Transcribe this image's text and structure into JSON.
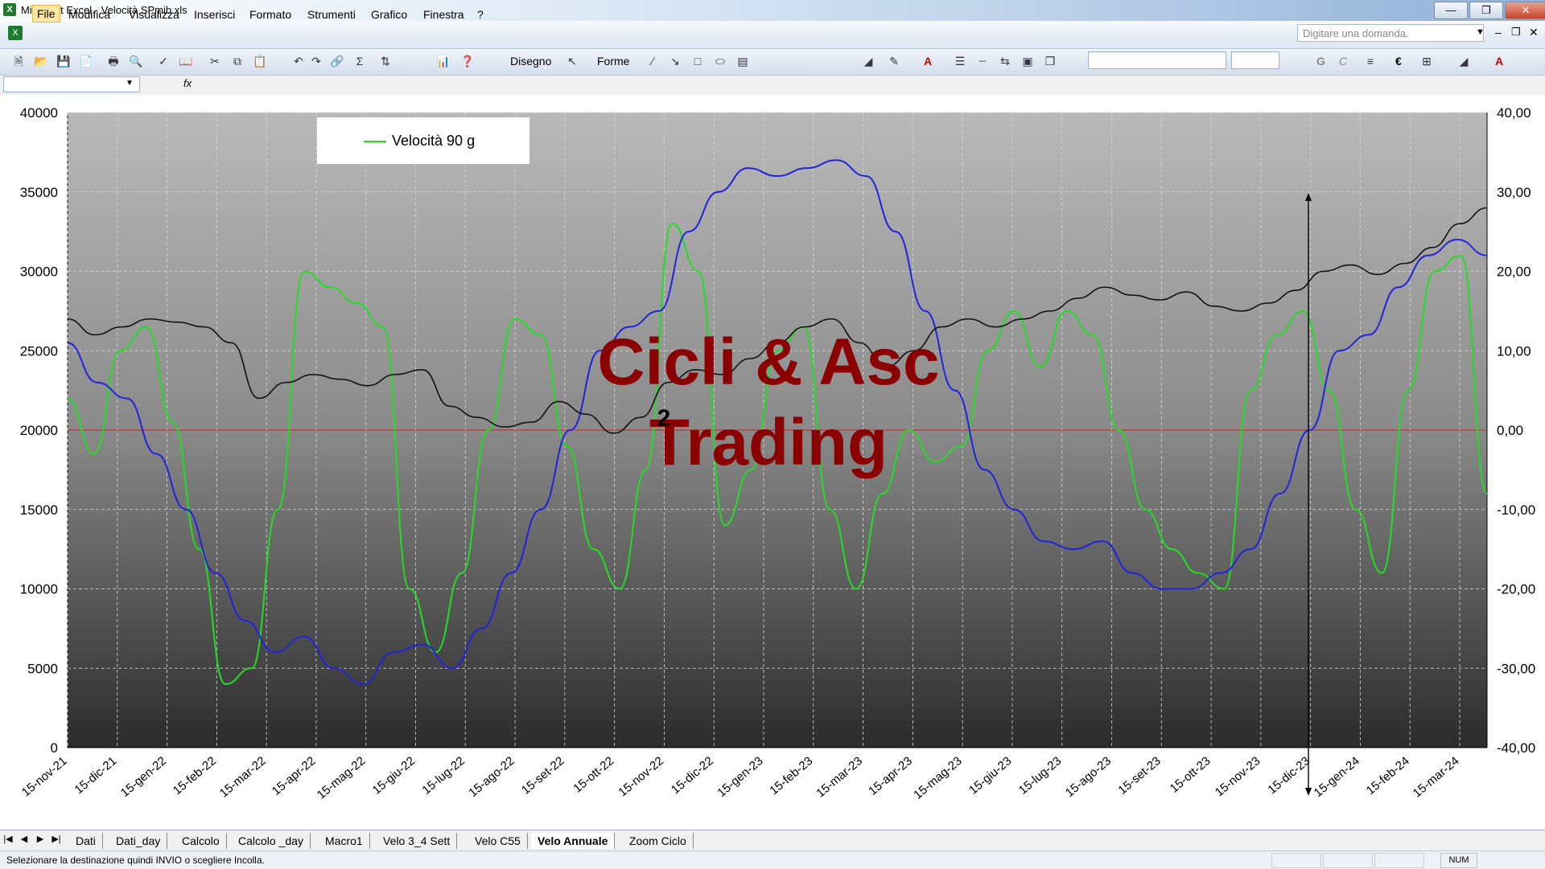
{
  "window": {
    "title": "Microsoft Excel - Velocità SPmib.xls",
    "icon": "excel-icon"
  },
  "menu": {
    "items": [
      "File",
      "Modifica",
      "Visualizza",
      "Inserisci",
      "Formato",
      "Strumenti",
      "Grafico",
      "Finestra",
      "?"
    ],
    "help_placeholder": "Digitare una domanda."
  },
  "toolbar": {
    "disegno_label": "Disegno",
    "forme_label": "Forme",
    "bold": "G",
    "italic": "C",
    "euro": "€"
  },
  "formula_bar": {
    "fx_label": "fx"
  },
  "chart": {
    "watermark_line1": "Cicli & Asc",
    "watermark_line2": "Trading",
    "marker_label": "2"
  },
  "chart_data": {
    "type": "line",
    "legend": {
      "entries": [
        "Velocità 90 g"
      ],
      "placement": "top-left"
    },
    "y_left": {
      "ylim": [
        0,
        40000
      ],
      "ticks": [
        "40000",
        "35000",
        "30000",
        "25000",
        "20000",
        "15000",
        "10000",
        "5000",
        "0"
      ]
    },
    "y_right": {
      "ylim": [
        -40,
        40
      ],
      "ticks": [
        "40,00",
        "30,00",
        "20,00",
        "10,00",
        "0,00",
        "-10,00",
        "-20,00",
        "-30,00",
        "-40,00"
      ]
    },
    "x_ticks": [
      "15-nov-21",
      "15-dic-21",
      "15-gen-22",
      "15-feb-22",
      "15-mar-22",
      "15-apr-22",
      "15-mag-22",
      "15-giu-22",
      "15-lug-22",
      "15-ago-22",
      "15-set-22",
      "15-ott-22",
      "15-nov-22",
      "15-dic-22",
      "15-gen-23",
      "15-feb-23",
      "15-mar-23",
      "15-apr-23",
      "15-mag-23",
      "15-giu-23",
      "15-lug-23",
      "15-ago-23",
      "15-set-23",
      "15-ott-23",
      "15-nov-23",
      "15-dic-23",
      "15-gen-24",
      "15-feb-24",
      "15-mar-24"
    ],
    "grid": true,
    "series": [
      {
        "name": "Velocità 90 g",
        "color": "#22dd22",
        "axis": "right",
        "values": [
          4,
          -3,
          10,
          13,
          1,
          -15,
          -32,
          -30,
          -10,
          20,
          18,
          16,
          13,
          -20,
          -28,
          -18,
          0,
          14,
          12,
          -2,
          -15,
          -20,
          -5,
          26,
          20,
          -12,
          -5,
          10,
          13,
          -10,
          -20,
          -8,
          0,
          -4,
          -2,
          10,
          15,
          8,
          15,
          12,
          0,
          -10,
          -15,
          -18,
          -20,
          5,
          12,
          15,
          5,
          -10,
          -18,
          5,
          20,
          22,
          -8
        ]
      },
      {
        "color": "#2222dd",
        "axis": "right",
        "values": [
          11,
          6,
          4,
          -3,
          -10,
          -18,
          -24,
          -28,
          -26,
          -30,
          -32,
          -28,
          -27,
          -30,
          -25,
          -18,
          -10,
          0,
          10,
          13,
          15,
          25,
          30,
          33,
          32,
          33,
          34,
          32,
          25,
          15,
          5,
          -5,
          -10,
          -14,
          -15,
          -14,
          -18,
          -20,
          -20,
          -18,
          -15,
          -8,
          0,
          10,
          12,
          18,
          22,
          24,
          22
        ]
      },
      {
        "color": "#111111",
        "axis": "left",
        "values": [
          27000,
          26000,
          26500,
          27000,
          26800,
          26500,
          25500,
          22000,
          23000,
          23500,
          23200,
          22800,
          23500,
          23800,
          21500,
          20800,
          20200,
          20500,
          21800,
          21000,
          19800,
          20800,
          23000,
          23800,
          23500,
          24500,
          25500,
          26500,
          27000,
          25500,
          24000,
          25000,
          26500,
          27000,
          26500,
          27000,
          27500,
          28300,
          29000,
          28500,
          28200,
          28700,
          27800,
          27500,
          28000,
          28800,
          30000,
          30400,
          29800,
          30500,
          31500,
          33000,
          34000
        ]
      }
    ],
    "reference_line": {
      "value": 0,
      "axis": "right",
      "color": "#cc2222"
    }
  },
  "sheet_tabs": [
    "Dati",
    "Dati_day",
    "Calcolo",
    "Calcolo _day",
    "Macro1",
    "Velo 3_4 Sett",
    "Velo C55",
    "Velo Annuale",
    "Zoom Ciclo"
  ],
  "active_tab": "Velo Annuale",
  "status": {
    "message": "Selezionare la destinazione quindi INVIO o scegliere Incolla.",
    "num": "NUM"
  }
}
